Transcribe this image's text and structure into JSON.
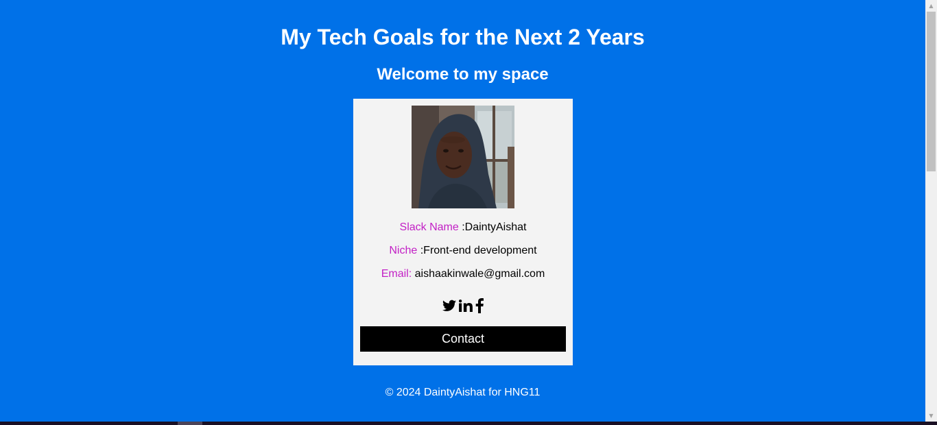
{
  "page": {
    "title": "My Tech Goals for the Next 2 Years",
    "subtitle": "Welcome to my space"
  },
  "profile": {
    "photo_icon": "portrait-photo",
    "rows": [
      {
        "label": "Slack Name",
        "separator": " :",
        "value": "DaintyAishat"
      },
      {
        "label": "Niche",
        "separator": " :",
        "value": "Front-end development"
      },
      {
        "label": "Email:",
        "separator": " ",
        "value": "aishaakinwale@gmail.com"
      }
    ],
    "socials": [
      "twitter-icon",
      "linkedin-icon",
      "facebook-icon"
    ],
    "contact_label": "Contact"
  },
  "footer": {
    "text": "© 2024 DaintyAishat for HNG11"
  },
  "colors": {
    "background": "#0071e8",
    "card": "#f3f3f3",
    "label_accent": "#c21fc5",
    "button": "#000000"
  }
}
